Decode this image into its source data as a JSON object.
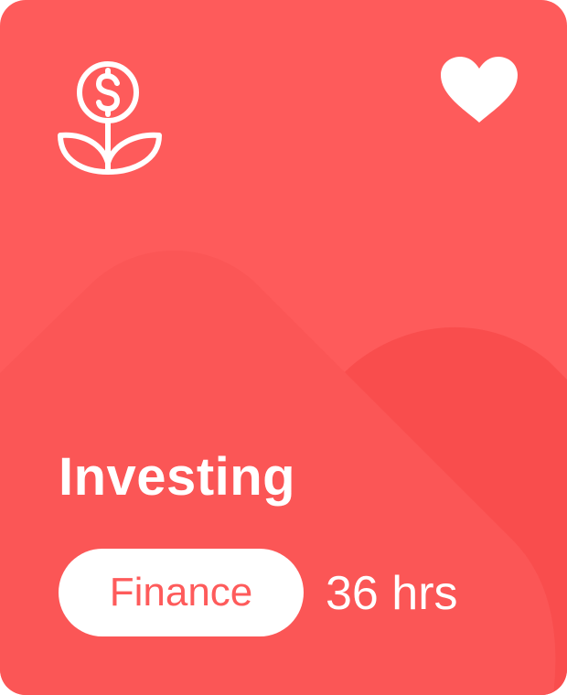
{
  "card": {
    "title": "Investing",
    "category": "Finance",
    "duration": "36 hrs",
    "icon": "money-plant-icon",
    "favorite_icon": "heart-icon",
    "colors": {
      "background": "#fe5b5b",
      "mountain_back": "#fb5656",
      "mountain_front": "#fd5959",
      "mountain_right": "#f94d4d",
      "foreground": "#ffffff"
    }
  }
}
